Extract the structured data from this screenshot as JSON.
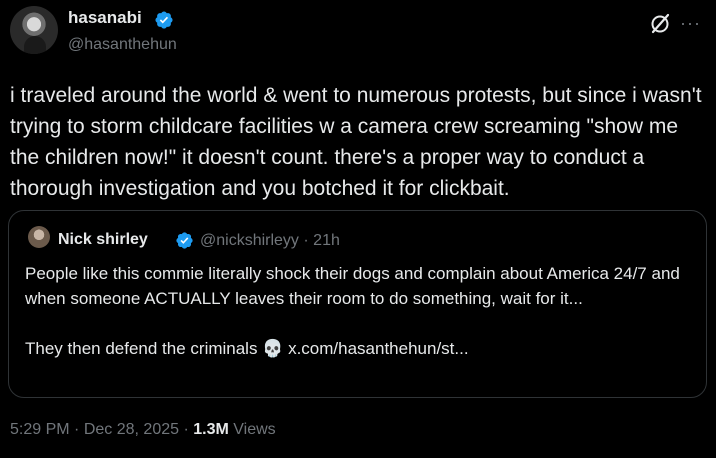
{
  "author": {
    "display_name": "hasanabi",
    "handle": "@hasanthehun",
    "verified": true
  },
  "tweet": {
    "text": "i traveled around the world & went to numerous protests, but since i wasn't trying to storm childcare facilities w a camera crew screaming \"show me the children now!\" it doesn't count. there's a proper way to conduct a thorough investigation and you botched it for clickbait."
  },
  "quoted_tweet": {
    "display_name": "Nick shirley",
    "handle": "@nickshirleyy",
    "time": "21h",
    "separator": "·",
    "text": "People like this commie literally shock their dogs and complain about America 24/7 and when someone ACTUALLY leaves their room to do something, wait for it...\n\nThey then defend the criminals 💀 x.com/hasanthehun/st..."
  },
  "meta": {
    "time": "5:29 PM",
    "date": "Dec 28, 2025",
    "separator": "·",
    "views_count": "1.3M",
    "views_label": "Views"
  },
  "icons": {
    "verified": "verified-badge-icon",
    "grok": "grok-icon",
    "more": "more-options-icon"
  },
  "colors": {
    "background": "#000000",
    "text": "#e7e9ea",
    "secondary": "#71767b",
    "verified": "#1d9bf0",
    "border": "#2f3336"
  }
}
